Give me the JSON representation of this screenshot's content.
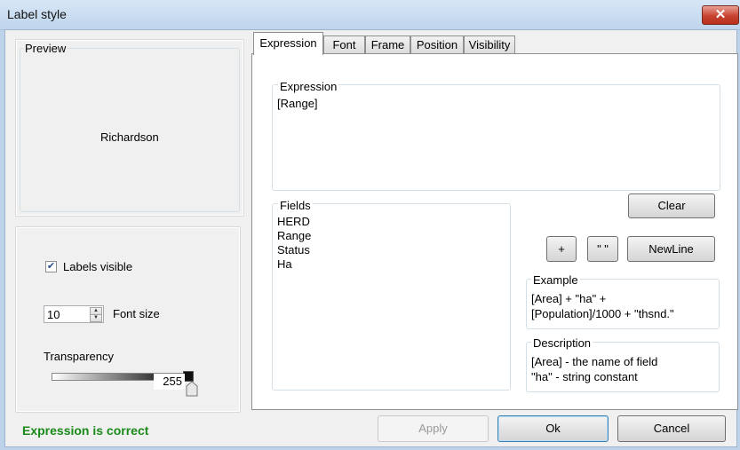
{
  "window": {
    "title": "Label style",
    "close_label": "✕"
  },
  "preview": {
    "legend": "Preview",
    "sample_text": "Richardson"
  },
  "options": {
    "labels_visible_label": "Labels visible",
    "labels_visible_checked": true,
    "font_size_value": "10",
    "font_size_label": "Font size",
    "transparency_label": "Transparency",
    "transparency_value": "255"
  },
  "tabs": [
    {
      "label": "Expression",
      "active": true
    },
    {
      "label": "Font"
    },
    {
      "label": "Frame"
    },
    {
      "label": "Position"
    },
    {
      "label": "Visibility"
    }
  ],
  "expression": {
    "legend": "Expression",
    "text": "[Range]",
    "clear_label": "Clear"
  },
  "fields": {
    "legend": "Fields",
    "items": [
      "HERD",
      "Range",
      "Status",
      "Ha"
    ]
  },
  "operators": {
    "plus": "+",
    "quotes": "\" \"",
    "newline": "NewLine"
  },
  "example": {
    "legend": "Example",
    "line1": "[Area] + \"ha\" +",
    "line2": "[Population]/1000 + \"thsnd.\""
  },
  "description": {
    "legend": "Description",
    "line1": "[Area]  - the name of field",
    "line2": "\"ha\" - string constant"
  },
  "footer": {
    "status": "Expression is correct",
    "status_color": "#1a8a1a",
    "apply_label": "Apply",
    "ok_label": "Ok",
    "cancel_label": "Cancel"
  }
}
